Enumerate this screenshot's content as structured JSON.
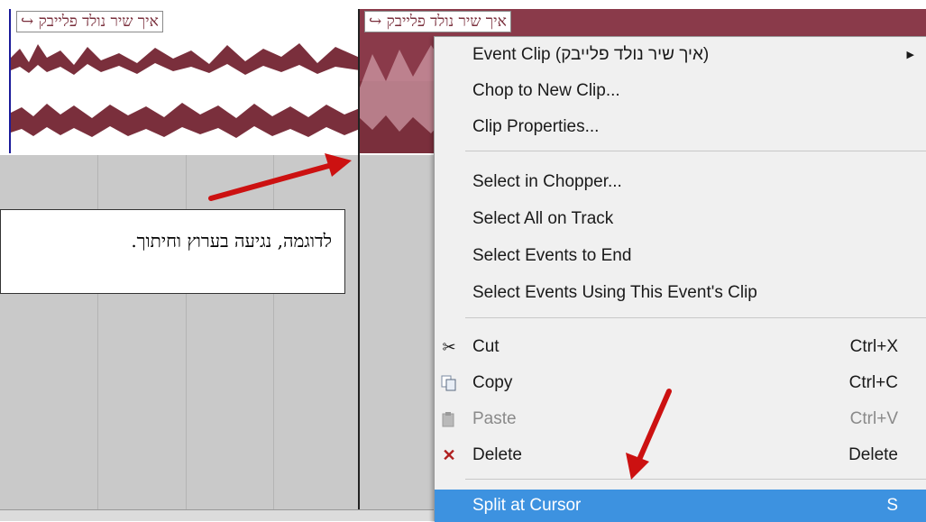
{
  "clips": {
    "clip1_label": "איך שיר נולד פלייבק",
    "clip2_label": "איך שיר נולד פלייבק",
    "link_icon": "arrow-icon"
  },
  "callout": {
    "text": "לדוגמה, נגיעה בערוץ וחיתוך."
  },
  "menu": {
    "items": [
      {
        "label": "Event Clip (איך שיר נולד פלייבק)",
        "shortcut": "",
        "submenu": true
      },
      {
        "label": "Chop to New Clip...",
        "shortcut": ""
      },
      {
        "label": "Clip Properties...",
        "shortcut": ""
      },
      {
        "label": "Select in Chopper...",
        "shortcut": ""
      },
      {
        "label": "Select All on Track",
        "shortcut": ""
      },
      {
        "label": "Select Events to End",
        "shortcut": ""
      },
      {
        "label": "Select Events Using This Event's Clip",
        "shortcut": ""
      },
      {
        "label": "Cut",
        "shortcut": "Ctrl+X",
        "icon": "scissors-icon"
      },
      {
        "label": "Copy",
        "shortcut": "Ctrl+C",
        "icon": "copy-icon"
      },
      {
        "label": "Paste",
        "shortcut": "Ctrl+V",
        "icon": "paste-icon",
        "disabled": true
      },
      {
        "label": "Delete",
        "shortcut": "Delete",
        "icon": "delete-icon"
      },
      {
        "label": "Split at Cursor",
        "shortcut": "S",
        "selected": true
      }
    ]
  },
  "colors": {
    "waveform": "#7a2f3c",
    "selection": "#3d92e0",
    "arrow": "#cc1111"
  }
}
